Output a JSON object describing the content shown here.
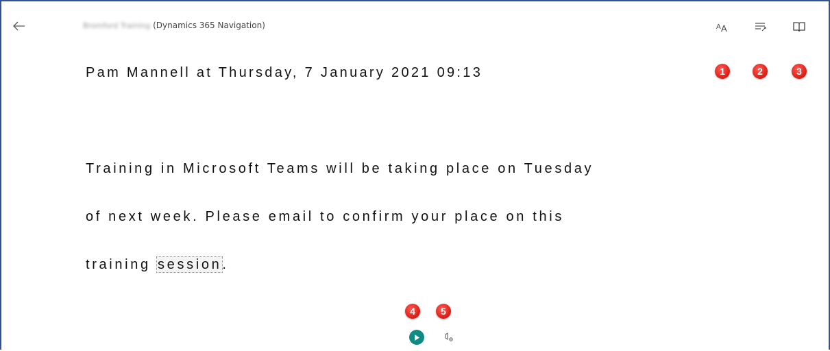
{
  "header": {
    "blurred_name": "Bromford Training",
    "title_suffix": "(Dynamics 365 Navigation)"
  },
  "toolbar": {
    "text_preferences_icon": "text-size-icon",
    "grammar_options_icon": "grammar-options-icon",
    "reading_preferences_icon": "book-icon"
  },
  "badges": {
    "b1": "1",
    "b2": "2",
    "b3": "3",
    "b4": "4",
    "b5": "5"
  },
  "content": {
    "heading": "Pam Mannell at Thursday, 7 January 2021 09:13",
    "line1": "Training in Microsoft Teams will be taking place on Tuesday",
    "line2": "of next week.  Please email to confirm your place on this",
    "line3_prefix": "training ",
    "line3_selected": "session",
    "line3_suffix": "."
  },
  "playback": {
    "play_icon": "play-icon",
    "voice_settings_icon": "voice-settings-icon"
  },
  "colors": {
    "frame_border": "#2f5496",
    "badge_red": "#e0231b",
    "play_teal": "#0f8a84"
  }
}
